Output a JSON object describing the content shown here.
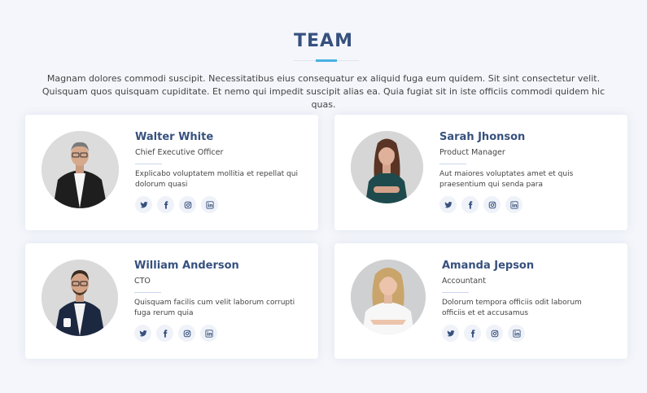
{
  "section": {
    "title": "TEAM",
    "intro": "Magnam dolores commodi suscipit. Necessitatibus eius consequatur ex aliquid fuga eum quidem. Sit sint consectetur velit. Quisquam quos quisquam cupiditate. Et nemo qui impedit suscipit alias ea. Quia fugiat sit in iste officiis commodi quidem hic quas."
  },
  "colors": {
    "heading": "#37517e",
    "accent": "#47b2e4",
    "background": "#f4f6fb",
    "social_bg": "#eff2f8"
  },
  "members": [
    {
      "name": "Walter White",
      "role": "Chief Executive Officer",
      "description": "Explicabo voluptatem mollitia et repellat qui dolorum quasi",
      "socials": [
        "twitter-icon",
        "facebook-icon",
        "instagram-icon",
        "linkedin-icon"
      ]
    },
    {
      "name": "Sarah Jhonson",
      "role": "Product Manager",
      "description": "Aut maiores voluptates amet et quis praesentium qui senda para",
      "socials": [
        "twitter-icon",
        "facebook-icon",
        "instagram-icon",
        "linkedin-icon"
      ]
    },
    {
      "name": "William Anderson",
      "role": "CTO",
      "description": "Quisquam facilis cum velit laborum corrupti fuga rerum quia",
      "socials": [
        "twitter-icon",
        "facebook-icon",
        "instagram-icon",
        "linkedin-icon"
      ]
    },
    {
      "name": "Amanda Jepson",
      "role": "Accountant",
      "description": "Dolorum tempora officiis odit laborum officiis et et accusamus",
      "socials": [
        "twitter-icon",
        "facebook-icon",
        "instagram-icon",
        "linkedin-icon"
      ]
    }
  ]
}
